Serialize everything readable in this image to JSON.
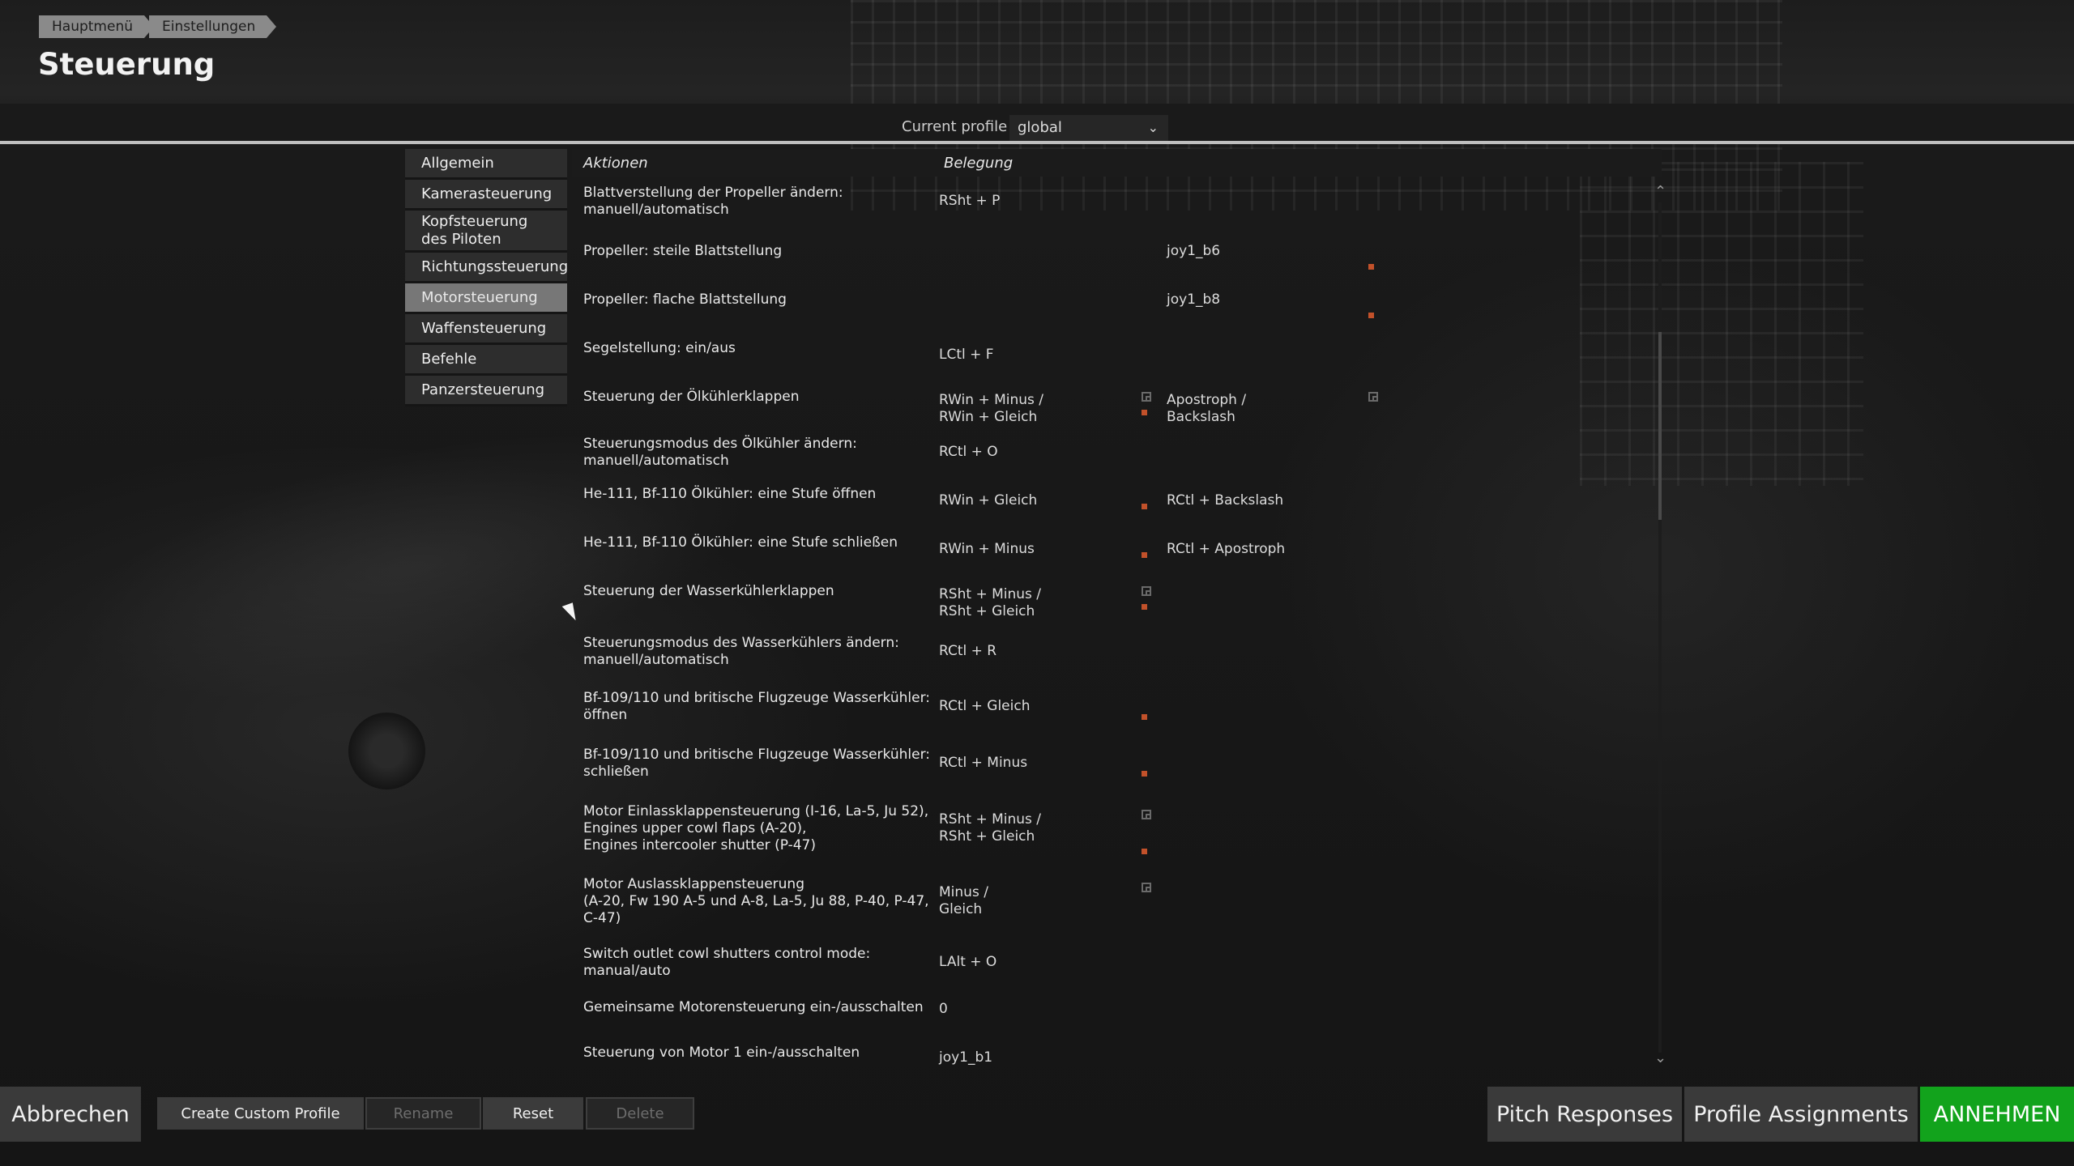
{
  "breadcrumb": [
    "Hauptmenü",
    "Einstellungen"
  ],
  "page_title": "Steuerung",
  "profile": {
    "label": "Current profile",
    "value": "global"
  },
  "categories": [
    {
      "label": "Allgemein"
    },
    {
      "label": "Kamerasteuerung"
    },
    {
      "label": "Kopfsteuerung des Piloten"
    },
    {
      "label": "Richtungssteuerung"
    },
    {
      "label": "Motorsteuerung"
    },
    {
      "label": "Waffensteuerung"
    },
    {
      "label": "Befehle"
    },
    {
      "label": "Panzersteuerung"
    }
  ],
  "table": {
    "col_actions": "Aktionen",
    "col_binding": "Belegung",
    "rows": [
      {
        "action": "Blattverstellung der Propeller ändern: manuell/automatisch",
        "b1": "RSht + P",
        "b2": ""
      },
      {
        "action": "Propeller: steile Blattstellung",
        "b1": "",
        "b2": "joy1_b6"
      },
      {
        "action": "Propeller: flache Blattstellung",
        "b1": "",
        "b2": "joy1_b8"
      },
      {
        "action": "Segelstellung: ein/aus",
        "b1": "LCtl + F",
        "b2": ""
      },
      {
        "action": "Steuerung der Ölkühlerklappen",
        "b1": "RWin + Minus /\nRWin + Gleich",
        "b2": "Apostroph /\nBackslash"
      },
      {
        "action": "Steuerungsmodus des Ölkühler ändern: manuell/automatisch",
        "b1": "RCtl + O",
        "b2": ""
      },
      {
        "action": "He-111, Bf-110 Ölkühler: eine Stufe öffnen",
        "b1": "RWin + Gleich",
        "b2": "RCtl + Backslash"
      },
      {
        "action": "He-111, Bf-110 Ölkühler: eine Stufe schließen",
        "b1": "RWin + Minus",
        "b2": "RCtl + Apostroph"
      },
      {
        "action": "Steuerung der Wasserkühlerklappen",
        "b1": "RSht + Minus /\nRSht + Gleich",
        "b2": ""
      },
      {
        "action": "Steuerungsmodus des Wasserkühlers ändern: manuell/automatisch",
        "b1": "RCtl + R",
        "b2": ""
      },
      {
        "action": "Bf-109/110 und britische Flugzeuge Wasserkühler: öffnen",
        "b1": "RCtl + Gleich",
        "b2": ""
      },
      {
        "action": "Bf-109/110 und britische Flugzeuge Wasserkühler: schließen",
        "b1": "RCtl + Minus",
        "b2": ""
      },
      {
        "action": "Motor Einlassklappensteuerung (I-16, La-5, Ju 52),\nEngines upper cowl flaps (A-20),\nEngines intercooler shutter (P-47)",
        "b1": "RSht + Minus /\nRSht + Gleich",
        "b2": ""
      },
      {
        "action": "Motor Auslassklappensteuerung\n(A-20, Fw 190 A-5 und A-8, La-5, Ju 88, P-40, P-47, C-47)",
        "b1": "Minus /\nGleich",
        "b2": ""
      },
      {
        "action": "Switch outlet cowl shutters control mode: manual/auto",
        "b1": "LAlt + O",
        "b2": ""
      },
      {
        "action": "Gemeinsame Motorensteuerung ein-/ausschalten",
        "b1": "0",
        "b2": ""
      },
      {
        "action": "Steuerung von Motor 1 ein-/ausschalten",
        "b1": "joy1_b1",
        "b2": ""
      }
    ]
  },
  "footer": {
    "cancel": "Abbrechen",
    "create_profile": "Create Custom Profile",
    "rename": "Rename",
    "reset": "Reset",
    "delete": "Delete",
    "pitch_responses": "Pitch Responses",
    "profile_assignments": "Profile Assignments",
    "accept": "ANNEHMEN"
  },
  "colors": {
    "accept": "#12a31c",
    "lock_icon": "#c2512a",
    "active_category": "#777777"
  }
}
